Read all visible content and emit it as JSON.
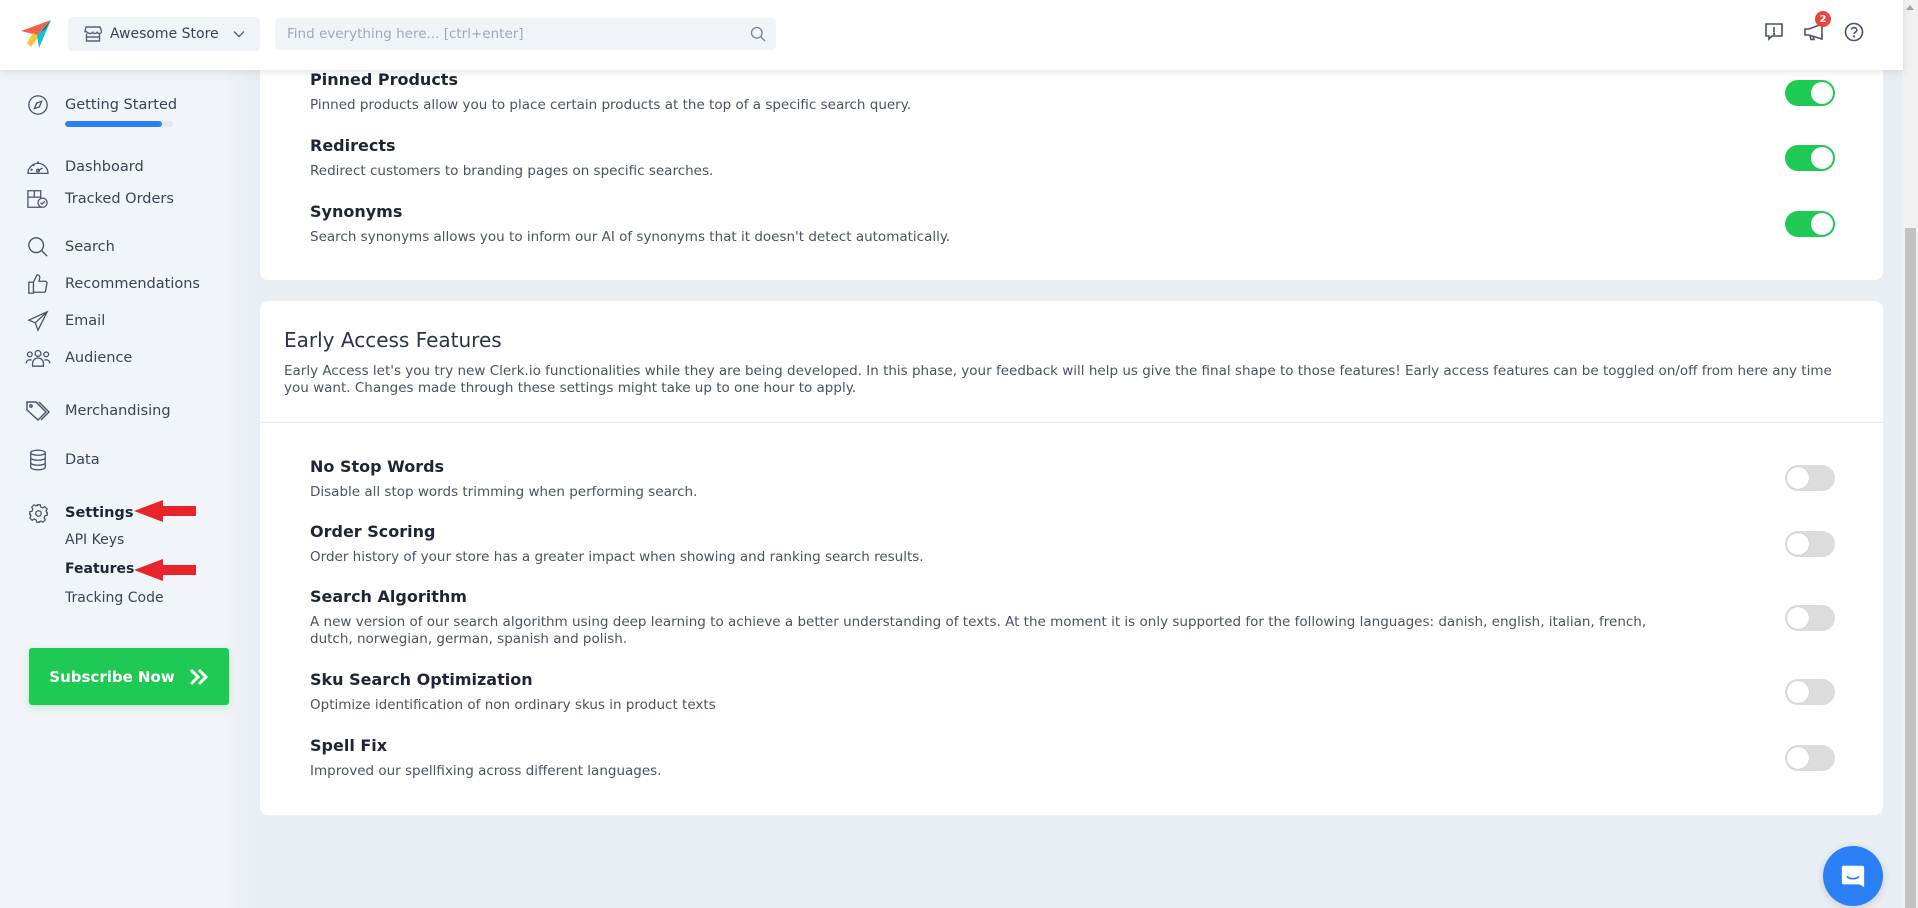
{
  "header": {
    "store_name": "Awesome Store",
    "search_placeholder": "Find everything here... [ctrl+enter]",
    "notification_count": "2",
    "icons": [
      "logo-icon",
      "store-icon",
      "chevron-down-icon",
      "search-icon",
      "feedback-icon",
      "announcement-icon",
      "help-icon"
    ]
  },
  "sidebar": {
    "getting_started": {
      "label": "Getting Started",
      "progress_percent": 90
    },
    "items": [
      {
        "label": "Dashboard",
        "icon": "dashboard-icon"
      },
      {
        "label": "Tracked Orders",
        "icon": "tracked-orders-icon"
      },
      {
        "label": "Search",
        "icon": "search-icon"
      },
      {
        "label": "Recommendations",
        "icon": "thumbs-up-icon"
      },
      {
        "label": "Email",
        "icon": "paper-plane-icon"
      },
      {
        "label": "Audience",
        "icon": "users-icon"
      },
      {
        "label": "Merchandising",
        "icon": "tags-icon"
      },
      {
        "label": "Data",
        "icon": "database-icon"
      },
      {
        "label": "Settings",
        "icon": "gear-icon",
        "active": true
      }
    ],
    "settings_sub": [
      {
        "label": "API Keys",
        "active": false
      },
      {
        "label": "Features",
        "active": true
      },
      {
        "label": "Tracking Code",
        "active": false
      }
    ],
    "subscribe_label": "Subscribe Now"
  },
  "search_features": [
    {
      "title": "Pinned Products",
      "description": "Pinned products allow you to place certain products at the top of a specific search query.",
      "enabled": true
    },
    {
      "title": "Redirects",
      "description": "Redirect customers to branding pages on specific searches.",
      "enabled": true
    },
    {
      "title": "Synonyms",
      "description": "Search synonyms allows you to inform our AI of synonyms that it doesn't detect automatically.",
      "enabled": true
    }
  ],
  "early_access": {
    "title": "Early Access Features",
    "description": "Early Access let's you try new Clerk.io functionalities while they are being developed. In this phase, your feedback will help us give the final shape to those features! Early access features can be toggled on/off from here any time you want. Changes made through these settings might take up to one hour to apply.",
    "features": [
      {
        "title": "No Stop Words",
        "description": "Disable all stop words trimming when performing search.",
        "enabled": false
      },
      {
        "title": "Order Scoring",
        "description": "Order history of your store has a greater impact when showing and ranking search results.",
        "enabled": false
      },
      {
        "title": "Search Algorithm",
        "description": "A new version of our search algorithm using deep learning to achieve a better understanding of texts. At the moment it is only supported for the following languages: danish, english, italian, french, dutch, norwegian, german, spanish and polish.",
        "enabled": false
      },
      {
        "title": "Sku Search Optimization",
        "description": "Optimize identification of non ordinary skus in product texts",
        "enabled": false
      },
      {
        "title": "Spell Fix",
        "description": "Improved our spellfixing across different languages.",
        "enabled": false
      }
    ]
  },
  "colors": {
    "brand_green": "#1ec954",
    "accent_blue": "#2a7ff5",
    "badge_red": "#e8453c",
    "annotation_red": "#e8232a"
  }
}
